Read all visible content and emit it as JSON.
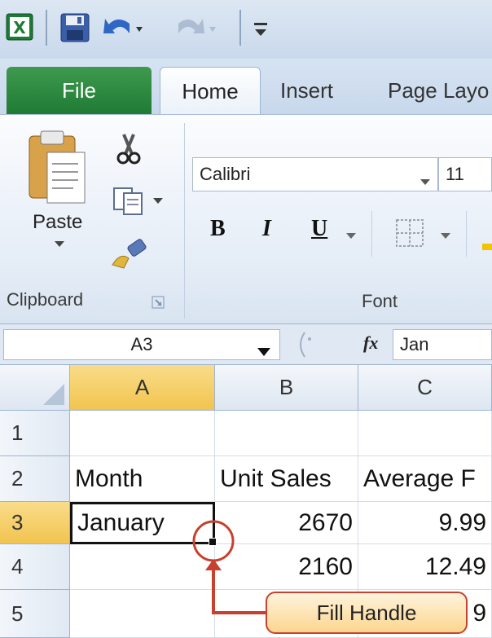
{
  "quick_access": {
    "app_icon": "excel-icon",
    "save_icon": "save-icon",
    "undo_icon": "undo-icon",
    "redo_icon": "redo-icon",
    "customize_icon": "customize-qat-icon"
  },
  "tabs": {
    "file": "File",
    "home": "Home",
    "insert": "Insert",
    "page_layout": "Page Layo"
  },
  "ribbon": {
    "clipboard": {
      "paste_label": "Paste",
      "group_label": "Clipboard"
    },
    "font": {
      "font_name": "Calibri",
      "font_size": "11",
      "bold": "B",
      "italic": "I",
      "underline": "U",
      "group_label": "Font"
    }
  },
  "formula_bar": {
    "name_box": "A3",
    "fx": "fx",
    "content": "Jan"
  },
  "grid": {
    "columns": [
      "A",
      "B",
      "C"
    ],
    "rows": [
      {
        "num": "1",
        "a": "",
        "b": "",
        "c": ""
      },
      {
        "num": "2",
        "a": "Month",
        "b": "Unit Sales",
        "c": "Average F"
      },
      {
        "num": "3",
        "a": "January",
        "b": "2670",
        "c": "9.99"
      },
      {
        "num": "4",
        "a": "",
        "b": "2160",
        "c": "12.49"
      },
      {
        "num": "5",
        "a": "",
        "b": "",
        "c": "9"
      }
    ],
    "selected_cell": "A3"
  },
  "callout": {
    "label": "Fill Handle"
  },
  "colors": {
    "file_tab": "#1f7a34",
    "selection_header": "#f2c44f",
    "callout_border": "#c8402e",
    "callout_fill": "#fbd58f"
  }
}
